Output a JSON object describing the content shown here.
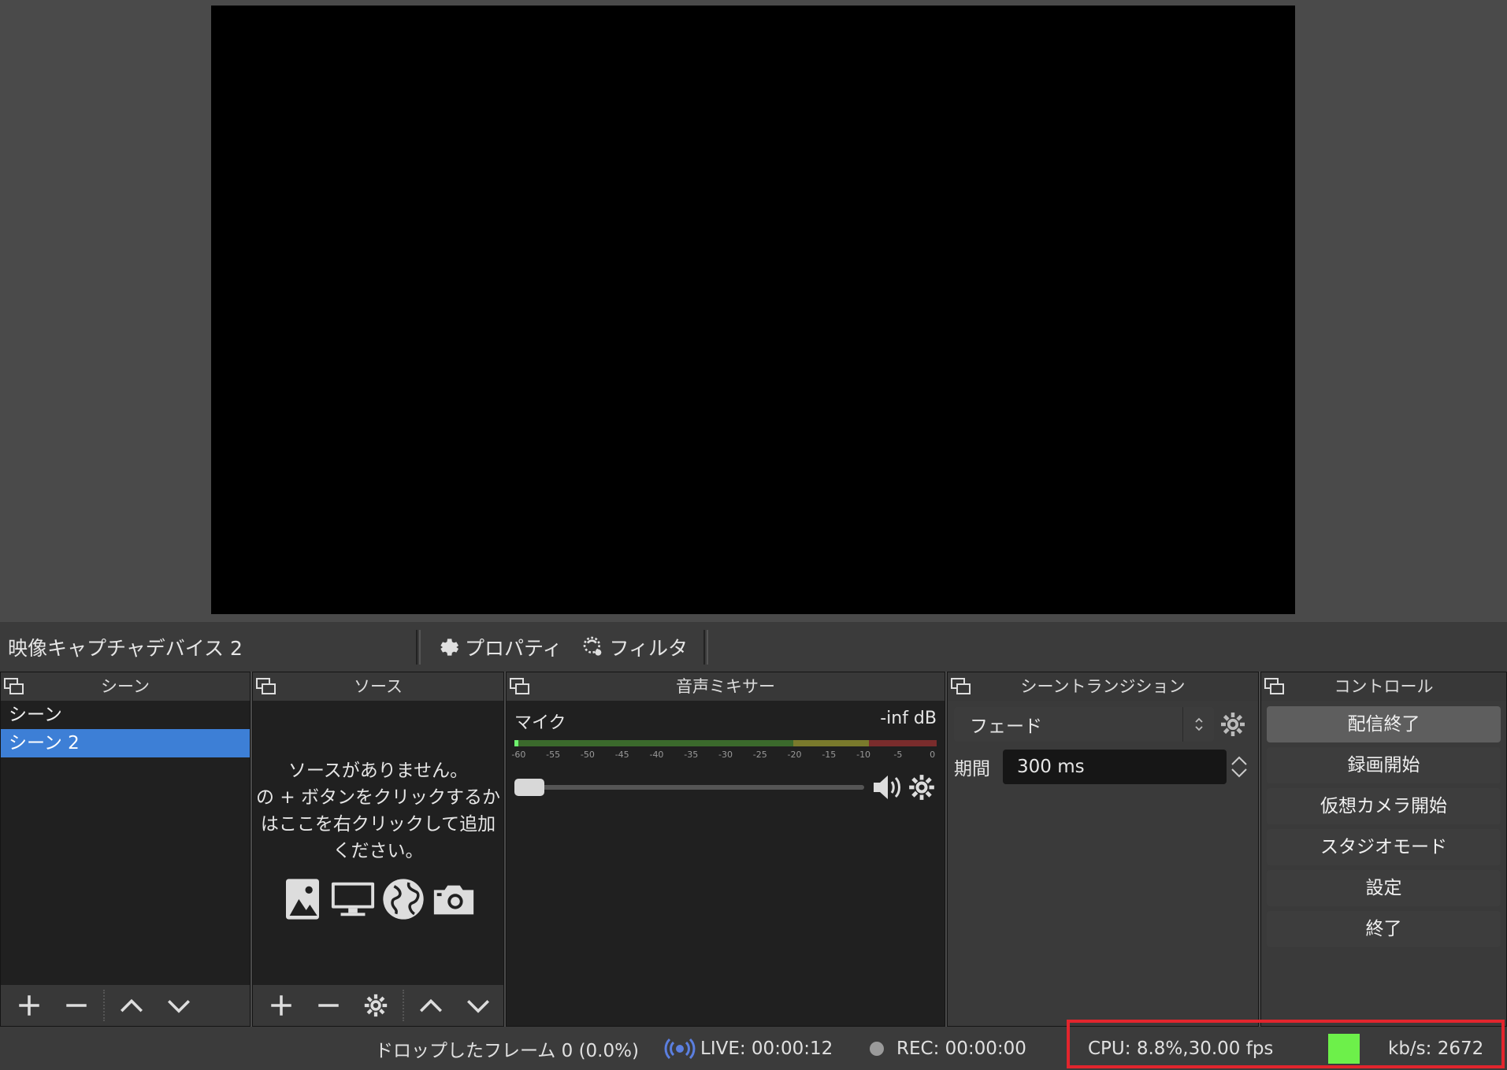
{
  "context_bar": {
    "source_name": "映像キャプチャデバイス 2",
    "properties_label": "プロパティ",
    "filters_label": "フィルタ"
  },
  "docks": {
    "scenes": {
      "title": "シーン",
      "items": [
        {
          "label": "シーン",
          "selected": false
        },
        {
          "label": "シーン 2",
          "selected": true
        }
      ]
    },
    "sources": {
      "title": "ソース",
      "empty_lines": [
        "ソースがありません。",
        "の + ボタンをクリックするか",
        "はここを右クリックして追加",
        "ください。"
      ],
      "icons": [
        "image-icon",
        "display-icon",
        "globe-icon",
        "camera-icon"
      ]
    },
    "mixer": {
      "title": "音声ミキサー",
      "channel": "マイク",
      "level": "-inf dB",
      "ticks": [
        "-60",
        "-55",
        "-50",
        "-45",
        "-40",
        "-35",
        "-30",
        "-25",
        "-20",
        "-15",
        "-10",
        "-5",
        "0"
      ],
      "volume": 0
    },
    "transitions": {
      "title": "シーントランジション",
      "selected": "フェード",
      "duration_label": "期間",
      "duration_value": "300 ms"
    },
    "controls": {
      "title": "コントロール",
      "buttons": [
        "配信終了",
        "録画開始",
        "仮想カメラ開始",
        "スタジオモード",
        "設定",
        "終了"
      ]
    }
  },
  "status": {
    "dropped_frames": "ドロップしたフレーム 0 (0.0%)",
    "live": "LIVE: 00:00:12",
    "rec": "REC: 00:00:00",
    "cpu": "CPU: 8.8%,30.00 fps",
    "kbps": "kb/s: 2672",
    "colors": {
      "stream_indicator": "#6df04a",
      "live_icon": "#5b7fe0",
      "highlight": "#e2252d"
    }
  }
}
